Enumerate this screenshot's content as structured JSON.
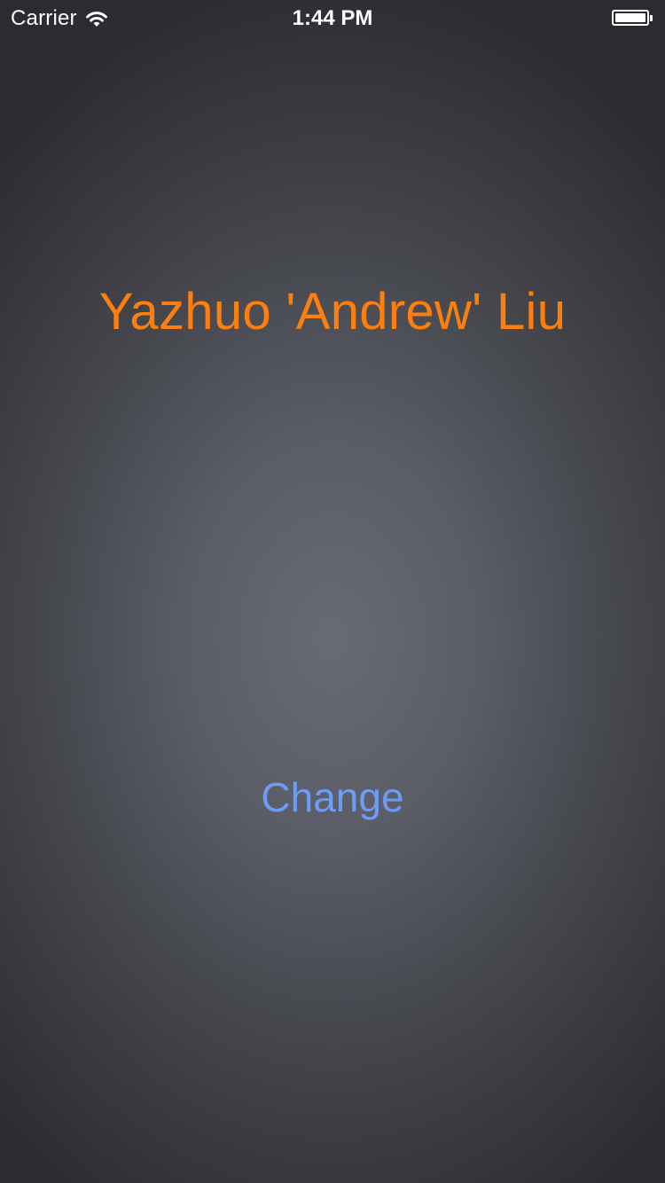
{
  "status_bar": {
    "carrier": "Carrier",
    "time": "1:44 PM",
    "wifi_icon": "wifi-icon",
    "battery_icon": "battery-icon",
    "battery_level": 1.0
  },
  "main": {
    "name": "Yazhuo 'Andrew' Liu",
    "change_label": "Change"
  },
  "colors": {
    "name_text": "#ff7f0e",
    "button_text": "#6d9cf7",
    "background_center": "#686b74",
    "background_edge": "#2b2c31"
  }
}
